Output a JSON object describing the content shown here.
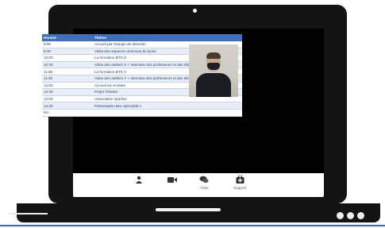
{
  "meeting": {
    "schedule": {
      "columns": [
        "Horaire",
        "Thème"
      ],
      "rows": [
        [
          "9:00",
          "Accueil par l'équipe de direction"
        ],
        [
          "9:30",
          "Visite des espaces communs du lycée"
        ],
        [
          "10:00",
          "La formation BTS X"
        ],
        [
          "10:30",
          "Visite des ateliers X + Interview des professeurs et des élèves"
        ],
        [
          "11:00",
          "La formation BTS Y"
        ],
        [
          "11:30",
          "Visite des ateliers Y + Interview des professeurs et des élèves"
        ],
        [
          "12:00",
          "Accueil vie scolaire"
        ],
        [
          "12:30",
          "Projet Théatre"
        ],
        [
          "14:00",
          "Association sportive"
        ],
        [
          "14:30",
          "Présentation Bac spécialité A"
        ],
        [
          "Etc.",
          ""
        ]
      ]
    },
    "toolbar": {
      "participants_label": "",
      "video_label": "",
      "chat_label": "Chat",
      "support_label": "Support"
    },
    "colors": {
      "table_header": "#3f6fba",
      "accent_line": "#2d74b8"
    }
  }
}
